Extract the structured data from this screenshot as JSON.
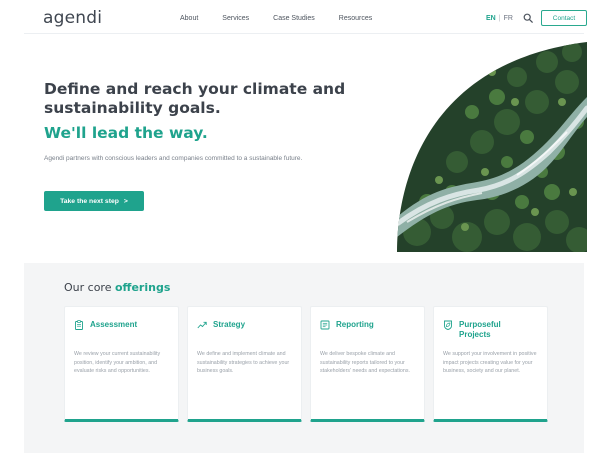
{
  "header": {
    "logo": "agendi",
    "nav": [
      "About",
      "Services",
      "Case Studies",
      "Resources"
    ],
    "lang_en": "EN",
    "lang_sep": "|",
    "lang_fr": "FR",
    "contact_label": "Contact"
  },
  "hero": {
    "title": "Define and reach your climate and sustainability goals.",
    "accent": "We'll lead the way.",
    "description": "Agendi partners with conscious leaders and companies committed to a sustainable future.",
    "cta_label": "Take the next step",
    "cta_arrow": ">"
  },
  "offerings": {
    "title_prefix": "Our core",
    "title_highlight": "offerings",
    "cards": [
      {
        "title": "Assessment",
        "icon": "clipboard-icon",
        "text": "We review your current sustainability position, identify your ambition, and evaluate risks and opportunities."
      },
      {
        "title": "Strategy",
        "icon": "trend-up-icon",
        "text": "We define and implement climate and sustainability strategies to achieve your business goals."
      },
      {
        "title": "Reporting",
        "icon": "report-icon",
        "text": "We deliver bespoke climate and sustainability reports tailored to your stakeholders' needs and expectations."
      },
      {
        "title": "Purposeful Projects",
        "icon": "leaf-badge-icon",
        "text": "We support your involvement in positive impact projects creating value for your business, society and our planet."
      }
    ]
  },
  "colors": {
    "accent": "#1fa38d",
    "text_dark": "#3c424b",
    "band_bg": "#f4f5f6"
  }
}
